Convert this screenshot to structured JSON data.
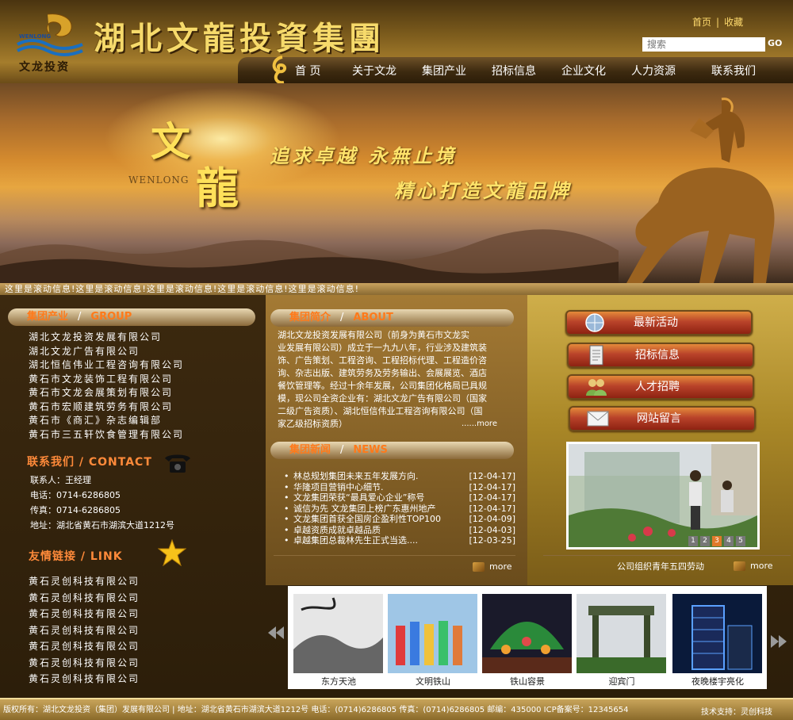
{
  "header": {
    "logo_text": "文龙投资",
    "logo_small": "WENLONG",
    "site_title": "湖北文龍投資集團",
    "toplinks": [
      "首页",
      "|",
      "收藏"
    ],
    "search_placeholder": "搜索",
    "search_button": "GO"
  },
  "nav": {
    "items": [
      "首 页",
      "关于文龙",
      "集团产业",
      "招标信息",
      "企业文化",
      "人力资源",
      "联系我们"
    ]
  },
  "banner": {
    "char1": "文",
    "char2": "龍",
    "en": "WENLONG",
    "slogan1": "追求卓越 永無止境",
    "slogan2": "精心打造文龍品牌"
  },
  "ticker": "这里是滚动信息!这里是滚动信息!这里是滚动信息!这里是滚动信息!这里是滚动信息!",
  "group": {
    "title_cn": "集团产业",
    "sep": "/",
    "title_en": "GROUP",
    "items": [
      "湖北文龙投资发展有限公司",
      "湖北文龙广告有限公司",
      "湖北恒信伟业工程咨询有限公司",
      "黄石市文龙装饰工程有限公司",
      "黄石市文龙会展策划有限公司",
      "黄石市宏顺建筑劳务有限公司",
      "黄石市《商汇》杂志编辑部",
      "黄石市三五轩饮食管理有限公司"
    ]
  },
  "contact": {
    "title": "联系我们 / CONTACT",
    "lines": [
      "联系人：王经理",
      "电话：0714-6286805",
      "传真：0714-6286805",
      "地址：湖北省黄石市湖滨大道1212号"
    ]
  },
  "links": {
    "title": "友情链接 / LINK",
    "items": [
      "黄石灵创科技有限公司",
      "黄石灵创科技有限公司",
      "黄石灵创科技有限公司",
      "黄石灵创科技有限公司",
      "黄石灵创科技有限公司",
      "黄石灵创科技有限公司",
      "黄石灵创科技有限公司"
    ]
  },
  "about": {
    "title_cn": "集团简介",
    "sep": "/",
    "title_en": "ABOUT",
    "lines": [
      "湖北文龙投资发展有限公司（前身为黄石市文龙实",
      "业发展有限公司）成立于一九九八年，行业涉及建筑装",
      "饰、广告策划、工程咨询、工程招标代理、工程造价咨",
      "询、杂志出版、建筑劳务及劳务输出、会展展览、酒店",
      "餐饮管理等。经过十余年发展，公司集团化格局已具规",
      "模，现公司全资企业有：湖北文龙广告有限公司（国家",
      "二级广告资质）、湖北恒信伟业工程咨询有限公司（国",
      "家乙级招标资质）"
    ],
    "more": "......more"
  },
  "news": {
    "title_cn": "集团新闻",
    "sep": "/",
    "title_en": "NEWS",
    "bullet": "•",
    "items": [
      {
        "title": "林总规划集团未来五年发展方向.",
        "date": "[12-04-17]"
      },
      {
        "title": "华隆项目营销中心细节.",
        "date": "[12-04-17]"
      },
      {
        "title": "文龙集团荣获“最具爱心企业”称号",
        "date": "[12-04-17]"
      },
      {
        "title": "诚信为先 文龙集团上榜广东惠州地产",
        "date": "[12-04-17]"
      },
      {
        "title": "文龙集团首获全国房企盈利性TOP100",
        "date": "[12-04-09]"
      },
      {
        "title": "卓越资质成就卓越品质",
        "date": "[12-04-03]"
      },
      {
        "title": "卓越集团总裁林先生正式当选....",
        "date": "[12-03-25]"
      }
    ],
    "more": "more"
  },
  "quick": {
    "items": [
      "最新活动",
      "招标信息",
      "人才招聘",
      "网站留言"
    ]
  },
  "photo": {
    "caption": "公司组织青年五四劳动",
    "pages": [
      "1",
      "2",
      "3",
      "4",
      "5"
    ],
    "more": "more"
  },
  "gallery": {
    "items": [
      "东方天池",
      "文明铁山",
      "铁山容景",
      "迎宾门",
      "夜晚楼宇亮化"
    ]
  },
  "footer": {
    "text": "版权所有：湖北文龙投资（集团）发展有限公司  |  地址：湖北省黄石市湖滨大道1212号  电话：(0714)6286805  传真：(0714)6286805  邮编：435000  ICP备案号：12345654",
    "tech": "技术支持：灵创科技"
  }
}
